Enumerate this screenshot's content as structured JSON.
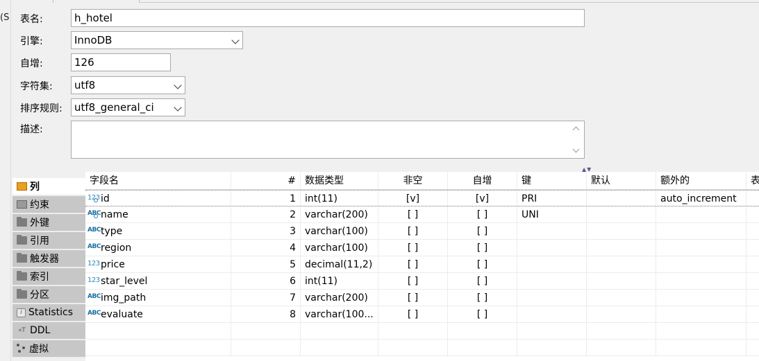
{
  "window": {
    "left_edge_glyph": "(S"
  },
  "form": {
    "table_name": {
      "label": "表名:",
      "value": "h_hotel"
    },
    "engine": {
      "label": "引擎:",
      "value": "InnoDB"
    },
    "auto_increment": {
      "label": "自增:",
      "value": "126"
    },
    "charset": {
      "label": "字符集:",
      "value": "utf8"
    },
    "collation": {
      "label": "排序规则:",
      "value": "utf8_general_ci"
    },
    "comment": {
      "label": "描述:",
      "value": ""
    }
  },
  "side_tabs": [
    {
      "label": "列",
      "icon": "columns-icon",
      "active": true
    },
    {
      "label": "约束",
      "icon": "constraint-icon",
      "active": false
    },
    {
      "label": "外键",
      "icon": "folder-icon",
      "active": false
    },
    {
      "label": "引用",
      "icon": "folder-icon",
      "active": false
    },
    {
      "label": "触发器",
      "icon": "folder-icon",
      "active": false
    },
    {
      "label": "索引",
      "icon": "folder-icon",
      "active": false
    },
    {
      "label": "分区",
      "icon": "folder-icon",
      "active": false
    },
    {
      "label": "Statistics",
      "icon": "info-icon",
      "active": false
    },
    {
      "label": "DDL",
      "icon": "ddl-icon",
      "active": false
    },
    {
      "label": "虚拟",
      "icon": "virtual-icon",
      "active": false
    }
  ],
  "grid": {
    "headers": {
      "name": "字段名",
      "num": "#",
      "type": "数据类型",
      "not_null": "非空",
      "auto_inc": "自增",
      "key": "键",
      "default": "默认",
      "extra": "额外的",
      "table": "表"
    },
    "rows": [
      {
        "icon": "123",
        "name": "id",
        "num": "1",
        "type": "int(11)",
        "not_null": "[v]",
        "auto_inc": "[v]",
        "key": "PRI",
        "default": "",
        "extra": "auto_increment"
      },
      {
        "icon": "ABC",
        "name": "name",
        "num": "2",
        "type": "varchar(200)",
        "not_null": "[ ]",
        "auto_inc": "[ ]",
        "key": "UNI",
        "default": "",
        "extra": ""
      },
      {
        "icon": "ABC",
        "name": "type",
        "num": "3",
        "type": "varchar(100)",
        "not_null": "[ ]",
        "auto_inc": "[ ]",
        "key": "",
        "default": "",
        "extra": ""
      },
      {
        "icon": "ABC",
        "name": "region",
        "num": "4",
        "type": "varchar(100)",
        "not_null": "[ ]",
        "auto_inc": "[ ]",
        "key": "",
        "default": "",
        "extra": ""
      },
      {
        "icon": "123",
        "name": "price",
        "num": "5",
        "type": "decimal(11,2)",
        "not_null": "[ ]",
        "auto_inc": "[ ]",
        "key": "",
        "default": "",
        "extra": ""
      },
      {
        "icon": "123",
        "name": "star_level",
        "num": "6",
        "type": "int(11)",
        "not_null": "[ ]",
        "auto_inc": "[ ]",
        "key": "",
        "default": "",
        "extra": ""
      },
      {
        "icon": "ABC",
        "name": "img_path",
        "num": "7",
        "type": "varchar(200)",
        "not_null": "[ ]",
        "auto_inc": "[ ]",
        "key": "",
        "default": "",
        "extra": ""
      },
      {
        "icon": "ABC",
        "name": "evaluate",
        "num": "8",
        "type": "varchar(100...",
        "not_null": "[ ]",
        "auto_inc": "[ ]",
        "key": "",
        "default": "",
        "extra": ""
      }
    ]
  }
}
